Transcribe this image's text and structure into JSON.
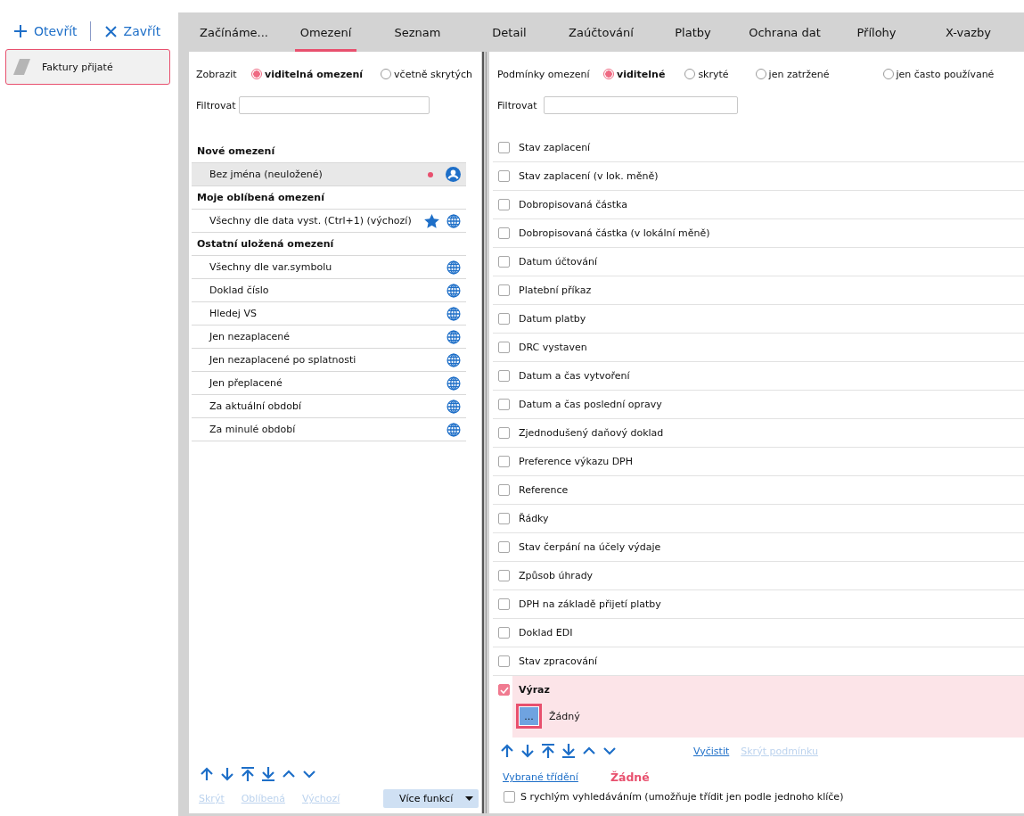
{
  "sidebar": {
    "actions": [
      {
        "label": "Otevřít",
        "kind": "open"
      },
      {
        "label": "Zavřít",
        "kind": "close"
      }
    ],
    "items": [
      {
        "label": "Faktury přijaté",
        "selected": true
      }
    ]
  },
  "tabs": [
    {
      "label": "Začínáme...",
      "selected": false
    },
    {
      "label": "Omezení",
      "selected": true
    },
    {
      "label": "Seznam",
      "selected": false
    },
    {
      "label": "Detail",
      "selected": false
    },
    {
      "label": "Zaúčtování",
      "selected": false
    },
    {
      "label": "Platby",
      "selected": false
    },
    {
      "label": "Ochrana dat",
      "selected": false
    },
    {
      "label": "Přílohy",
      "selected": false
    },
    {
      "label": "X-vazby",
      "selected": false
    }
  ],
  "left": {
    "show_label": "Zobrazit",
    "show_options": [
      {
        "label": "viditelná omezení",
        "selected": true
      },
      {
        "label": "včetně skrytých",
        "selected": false
      }
    ],
    "filter_label": "Filtrovat",
    "groups": [
      {
        "title": "Nové omezení",
        "items": [
          {
            "label": "Bez jména (neuložené)",
            "selected": true,
            "unsaved": true,
            "favorite": false,
            "personal": true
          }
        ]
      },
      {
        "title": "Moje oblíbená omezení",
        "items": [
          {
            "label": "Všechny dle data vyst. (Ctrl+1) (výchozí)",
            "selected": false,
            "unsaved": false,
            "favorite": true,
            "personal": false
          }
        ]
      },
      {
        "title": "Ostatní uložená omezení",
        "items": [
          {
            "label": "Všechny dle var.symbolu",
            "selected": false,
            "unsaved": false,
            "favorite": false,
            "personal": false
          },
          {
            "label": "Doklad číslo",
            "selected": false,
            "unsaved": false,
            "favorite": false,
            "personal": false
          },
          {
            "label": "Hledej VS",
            "selected": false,
            "unsaved": false,
            "favorite": false,
            "personal": false
          },
          {
            "label": "Jen nezaplacené",
            "selected": false,
            "unsaved": false,
            "favorite": false,
            "personal": false
          },
          {
            "label": "Jen nezaplacené po splatnosti",
            "selected": false,
            "unsaved": false,
            "favorite": false,
            "personal": false
          },
          {
            "label": "Jen přeplacené",
            "selected": false,
            "unsaved": false,
            "favorite": false,
            "personal": false
          },
          {
            "label": "Za aktuální období",
            "selected": false,
            "unsaved": false,
            "favorite": false,
            "personal": false
          },
          {
            "label": "Za minulé období",
            "selected": false,
            "unsaved": false,
            "favorite": false,
            "personal": false
          }
        ]
      }
    ],
    "links": [
      {
        "label": "Skrýt",
        "disabled": true
      },
      {
        "label": "Oblíbená",
        "disabled": true
      },
      {
        "label": "Výchozí",
        "disabled": true
      }
    ],
    "more_button": "Více funkcí"
  },
  "right": {
    "conditions_label": "Podmínky omezení",
    "condition_options": [
      {
        "label": "viditelné",
        "selected": true
      },
      {
        "label": "skryté",
        "selected": false
      },
      {
        "label": "jen zatržené",
        "selected": false
      },
      {
        "label": "jen často používané",
        "selected": false
      }
    ],
    "filter_label": "Filtrovat",
    "conditions": [
      {
        "label": "Stav zaplacení",
        "checked": false
      },
      {
        "label": "Stav zaplacení (v lok. měně)",
        "checked": false
      },
      {
        "label": "Dobropisovaná částka",
        "checked": false
      },
      {
        "label": "Dobropisovaná částka (v lokální měně)",
        "checked": false
      },
      {
        "label": "Datum účtování",
        "checked": false
      },
      {
        "label": "Platební příkaz",
        "checked": false
      },
      {
        "label": "Datum platby",
        "checked": false
      },
      {
        "label": "DRC vystaven",
        "checked": false
      },
      {
        "label": "Datum a čas vytvoření",
        "checked": false
      },
      {
        "label": "Datum a čas poslední opravy",
        "checked": false
      },
      {
        "label": "Zjednodušený daňový doklad",
        "checked": false
      },
      {
        "label": "Preference výkazu DPH",
        "checked": false
      },
      {
        "label": "Reference",
        "checked": false
      },
      {
        "label": "Řádky",
        "checked": false
      },
      {
        "label": "Stav čerpání na účely výdaje",
        "checked": false
      },
      {
        "label": "Způsob úhrady",
        "checked": false
      },
      {
        "label": "DPH na základě přijetí platby",
        "checked": false
      },
      {
        "label": "Doklad EDI",
        "checked": false
      },
      {
        "label": "Stav zpracování",
        "checked": false
      },
      {
        "label": "Výraz",
        "checked": true,
        "kind": "expression",
        "button": "...",
        "value": "Žádný"
      }
    ],
    "links": [
      {
        "label": "Vyčistit",
        "disabled": false
      },
      {
        "label": "Skrýt podmínku",
        "disabled": true
      }
    ],
    "sort_link": "Vybrané třídění",
    "sort_value": "Žádné",
    "quick_search": {
      "label": "S rychlým vyhledáváním (umožňuje třídit jen podle jednoho klíče)",
      "checked": false
    }
  }
}
